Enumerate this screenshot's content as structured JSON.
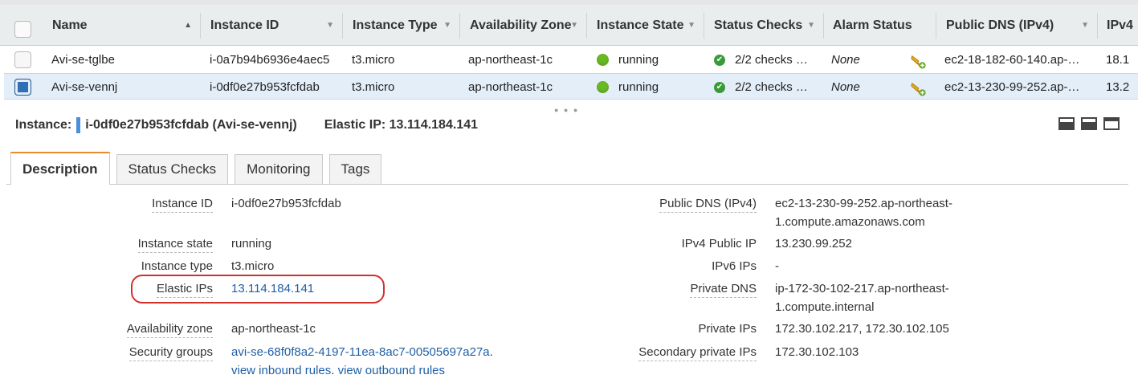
{
  "table": {
    "columns": [
      "Name",
      "Instance ID",
      "Instance Type",
      "Availability Zone",
      "Instance State",
      "Status Checks",
      "Alarm Status",
      "Public DNS (IPv4)",
      "IPv4"
    ],
    "rows": [
      {
        "name": "Avi-se-tglbe",
        "instance_id": "i-0a7b94b6936e4aec5",
        "instance_type": "t3.micro",
        "availability_zone": "ap-northeast-1c",
        "state": "running",
        "status_checks": "2/2 checks …",
        "alarm_status": "None",
        "public_dns": "ec2-18-182-60-140.ap-…",
        "ipv4": "18.1",
        "selected": false
      },
      {
        "name": "Avi-se-vennj",
        "instance_id": "i-0df0e27b953fcfdab",
        "instance_type": "t3.micro",
        "availability_zone": "ap-northeast-1c",
        "state": "running",
        "status_checks": "2/2 checks …",
        "alarm_status": "None",
        "public_dns": "ec2-13-230-99-252.ap-…",
        "ipv4": "13.2",
        "selected": true
      }
    ]
  },
  "instance_header": {
    "label": "Instance:",
    "id_name": "i-0df0e27b953fcfdab (Avi-se-vennj)",
    "elastic_ip": "Elastic IP: 13.114.184.141"
  },
  "tabs": [
    "Description",
    "Status Checks",
    "Monitoring",
    "Tags"
  ],
  "description": {
    "left": {
      "instance_id": {
        "label": "Instance ID",
        "value": "i-0df0e27b953fcfdab"
      },
      "instance_state": {
        "label": "Instance state",
        "value": "running"
      },
      "instance_type": {
        "label": "Instance type",
        "value": "t3.micro"
      },
      "elastic_ips": {
        "label": "Elastic IPs",
        "value": "13.114.184.141"
      },
      "availability_zone": {
        "label": "Availability zone",
        "value": "ap-northeast-1c"
      },
      "security_groups": {
        "label": "Security groups",
        "group": "avi-se-68f0f8a2-4197-11ea-8ac7-00505697a27a",
        "dot": ".",
        "inbound": "view inbound rules",
        "outbound": "view outbound rules"
      }
    },
    "right": {
      "public_dns": {
        "label": "Public DNS (IPv4)",
        "line1": "ec2-13-230-99-252.ap-northeast-",
        "line2": "1.compute.amazonaws.com"
      },
      "ipv4_public_ip": {
        "label": "IPv4 Public IP",
        "value": "13.230.99.252"
      },
      "ipv6_ips": {
        "label": "IPv6 IPs",
        "value": "-"
      },
      "private_dns": {
        "label": "Private DNS",
        "line1": "ip-172-30-102-217.ap-northeast-",
        "line2": "1.compute.internal"
      },
      "private_ips": {
        "label": "Private IPs",
        "value": "172.30.102.217, 172.30.102.105"
      },
      "secondary_private_ips": {
        "label": "Secondary private IPs",
        "value": "172.30.102.103"
      }
    }
  },
  "colors": {
    "accent_tab": "#e88b2e",
    "link": "#1f5fa6",
    "running_green": "#69b923",
    "highlight_circle": "#d0312d",
    "selected_row": "#e4eef9"
  }
}
